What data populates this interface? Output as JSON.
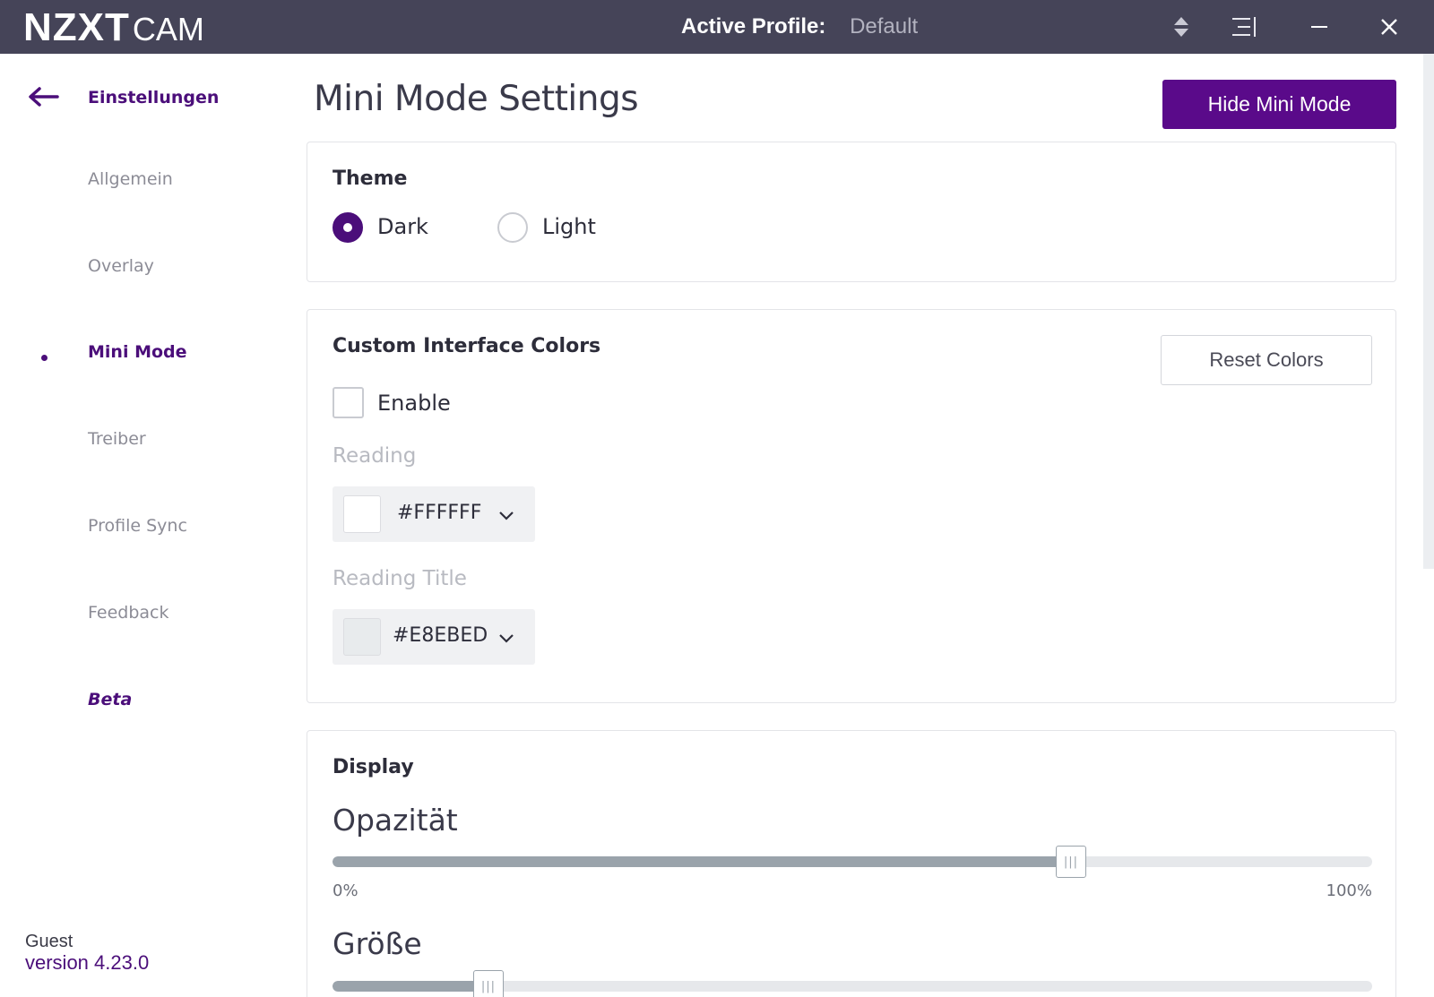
{
  "titlebar": {
    "logo_main": "NZXT",
    "logo_sub": "CAM",
    "active_profile_label": "Active Profile:",
    "active_profile_value": "Default",
    "icons": [
      "profile-switch-icon",
      "menu-icon",
      "minimize-icon",
      "close-icon"
    ]
  },
  "sidebar": {
    "back_label": "Einstellungen",
    "items": [
      {
        "label": "Allgemein",
        "active": false
      },
      {
        "label": "Overlay",
        "active": false
      },
      {
        "label": "Mini Mode",
        "active": true
      },
      {
        "label": "Treiber",
        "active": false
      },
      {
        "label": "Profile Sync",
        "active": false
      },
      {
        "label": "Feedback",
        "active": false
      },
      {
        "label": "Beta",
        "active": false
      }
    ],
    "user": "Guest",
    "version": "version 4.23.0"
  },
  "main": {
    "title": "Mini Mode Settings",
    "hide_button": "Hide Mini Mode",
    "theme": {
      "title": "Theme",
      "options": [
        {
          "label": "Dark",
          "checked": true
        },
        {
          "label": "Light",
          "checked": false
        }
      ]
    },
    "colors": {
      "title": "Custom Interface Colors",
      "reset_button": "Reset Colors",
      "enable_label": "Enable",
      "enable_checked": false,
      "reading_label": "Reading",
      "reading_value": "#FFFFFF",
      "reading_title_label": "Reading Title",
      "reading_title_value": "#E8EBED"
    },
    "display": {
      "title": "Display",
      "opacity_label": "Opazität",
      "opacity_value": 0.71,
      "opacity_min": "0%",
      "opacity_max": "100%",
      "size_label": "Größe",
      "size_value": 0.15
    }
  },
  "colors": {
    "accent": "#5A0A8A",
    "titlebar": "#454458",
    "slider_fill": "#9AA3AB"
  }
}
